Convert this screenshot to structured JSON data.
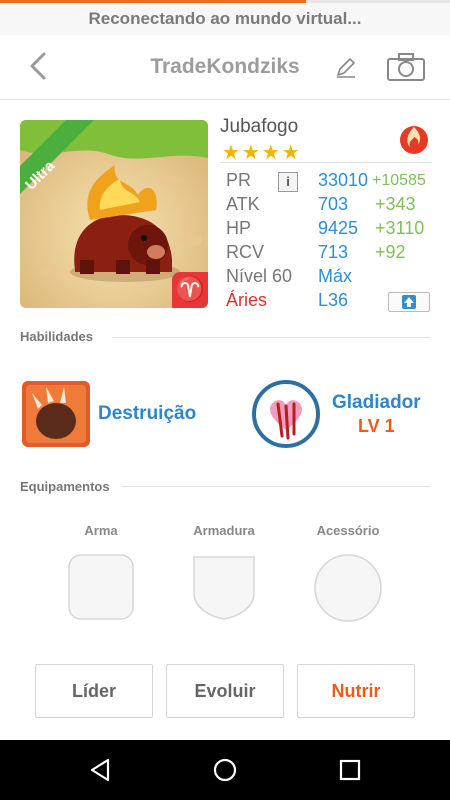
{
  "status": {
    "text": "Reconectando ao mundo virtual...",
    "progress": 0.68
  },
  "header": {
    "title": "TradeKondziks",
    "back_icon": "chevron-left-icon",
    "edit_icon": "pencil-icon",
    "camera_icon": "camera-icon"
  },
  "monster": {
    "badge": "Ultra",
    "name": "Jubafogo",
    "stars": "★★★★",
    "element_icon": "fire-icon",
    "zodiac_symbol": "♈"
  },
  "stats": {
    "pr": {
      "label": "PR",
      "value": "33010",
      "bonus": "+10585"
    },
    "atk": {
      "label": "ATK",
      "value": "703",
      "bonus": "+343"
    },
    "hp": {
      "label": "HP",
      "value": "9425",
      "bonus": "+3110"
    },
    "rcv": {
      "label": "RCV",
      "value": "713",
      "bonus": "+92"
    },
    "level": {
      "label": "Nível 60",
      "value": "Máx"
    },
    "sign": {
      "label": "Áries",
      "value": "L36"
    },
    "info_icon": "i"
  },
  "abilities": {
    "heading": "Habilidades",
    "skill1": "Destruição",
    "skill2": "Gladiador",
    "skill2_level": "LV 1"
  },
  "equipment": {
    "heading": "Equipamentos",
    "slots": [
      "Arma",
      "Armadura",
      "Acessório"
    ]
  },
  "actions": {
    "leader": "Líder",
    "evolve": "Evoluir",
    "feed": "Nutrir"
  },
  "colors": {
    "accent": "#f26a1b",
    "blue": "#2f8fd1",
    "green": "#7ec05a",
    "red": "#e8353a"
  }
}
